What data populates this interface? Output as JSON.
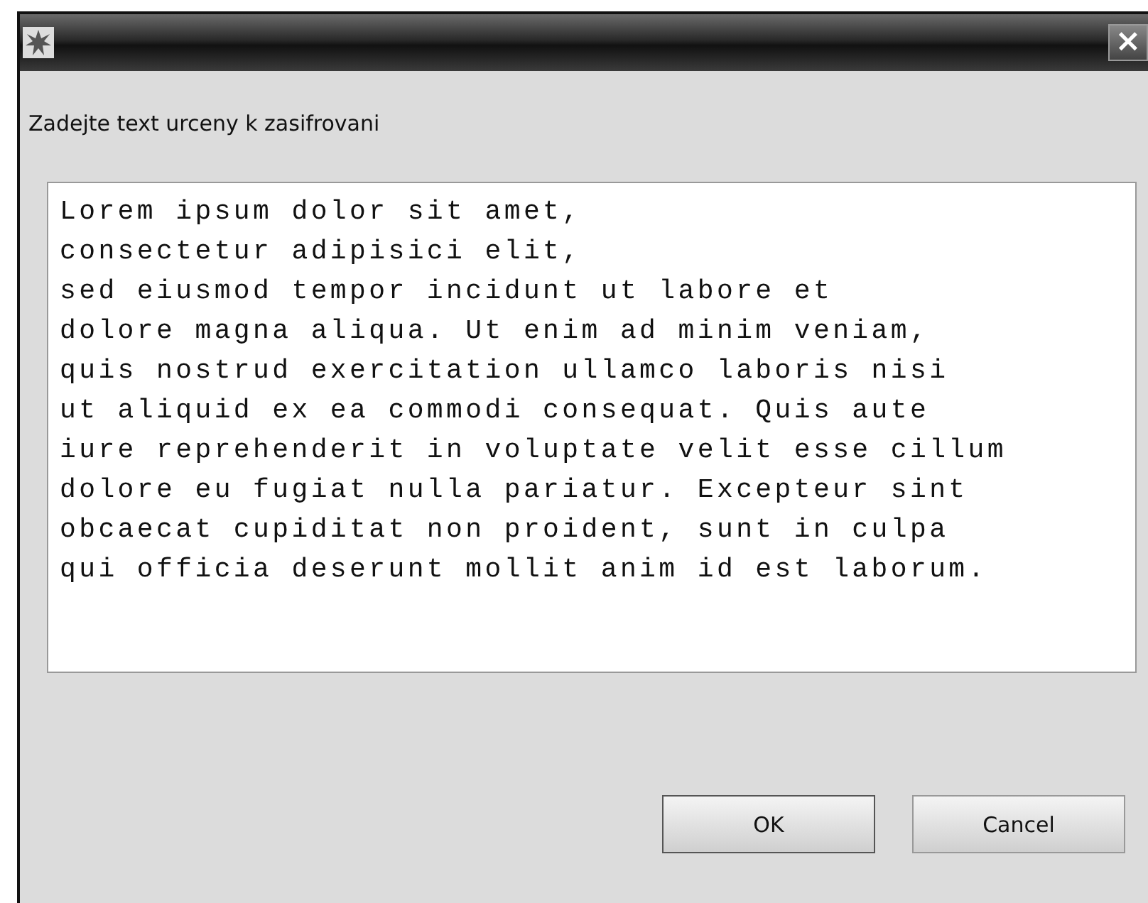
{
  "window": {
    "close_label": "×"
  },
  "prompt": "Zadejte text urceny k zasifrovani",
  "text_area": {
    "lines": [
      "Lorem ipsum dolor sit amet,",
      "consectetur adipisici elit,",
      "sed eiusmod tempor incidunt ut labore et",
      "dolore magna aliqua. Ut enim ad minim veniam,",
      "quis nostrud exercitation ullamco laboris nisi",
      "ut aliquid ex ea commodi consequat. Quis aute",
      "iure reprehenderit in voluptate velit esse cillum",
      "dolore eu fugiat nulla pariatur. Excepteur sint",
      "obcaecat cupiditat non proident, sunt in culpa",
      "qui officia deserunt mollit anim id est laborum."
    ]
  },
  "buttons": [
    {
      "label": "OK",
      "kind": "primary"
    },
    {
      "label": "Cancel",
      "kind": "secondary"
    }
  ]
}
